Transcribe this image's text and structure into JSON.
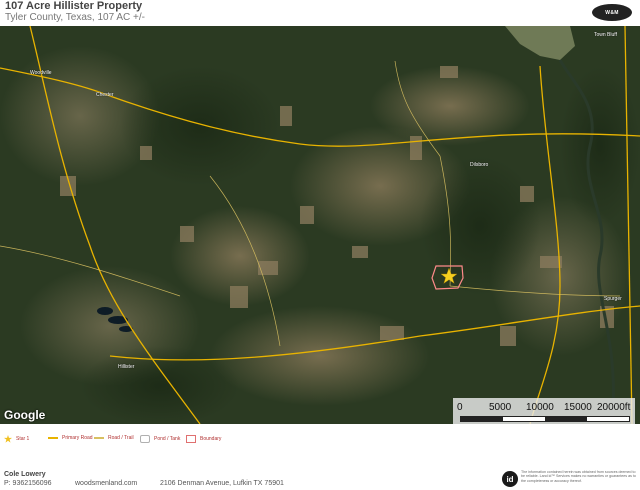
{
  "header": {
    "title": "107 Acre Hillister Property",
    "subtitle": "Tyler County, Texas, 107 AC +/-",
    "brand": "WOODS & MEN REALTY"
  },
  "map": {
    "attribution": "Google",
    "places": [
      "Town Bluff",
      "Dilsboro",
      "Spurger",
      "Hillister",
      "Woodville",
      "Chester"
    ],
    "scale": {
      "labels": [
        "0",
        "5000",
        "10000",
        "15000",
        "20000ft"
      ]
    }
  },
  "legend": {
    "items": [
      {
        "label": "Star 1",
        "color": "#f0c020",
        "kind": "star"
      },
      {
        "label": "Primary Road",
        "color": "#e8b300",
        "kind": "line"
      },
      {
        "label": "Road / Trail",
        "color": "#d8c060",
        "kind": "dash"
      },
      {
        "label": "Pond / Tank",
        "color": "#b0b0b0",
        "kind": "pond"
      },
      {
        "label": "Boundary",
        "color": "#e07070",
        "kind": "boundary"
      }
    ]
  },
  "footer": {
    "agent_name": "Cole Lowery",
    "agent_phone": "P: 9362156096",
    "website": "woodsmenland.com",
    "address": "2106 Denman Avenue, Lufkin TX 75901",
    "id_logo": "id",
    "disclaimer": "The information contained herein was obtained from sources deemed to be reliable. Land id™ Services makes no warranties or guarantees as to the completeness or accuracy thereof."
  }
}
